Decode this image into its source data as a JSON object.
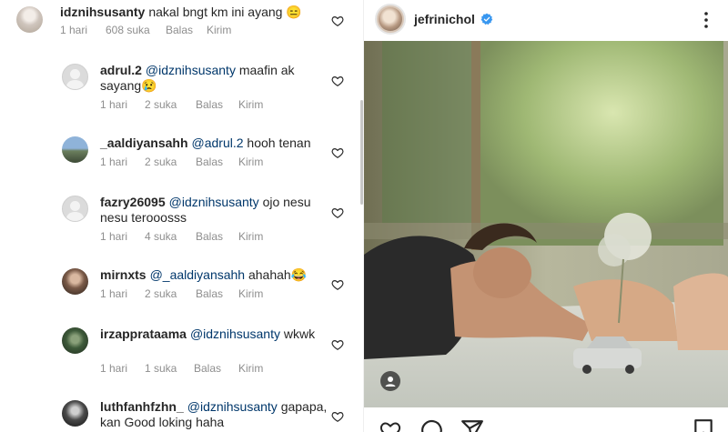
{
  "comments": [
    {
      "username": "idznihsusanty",
      "mention": "",
      "text": "nakal bngt km ini ayang 😑",
      "time": "1 hari",
      "likes": "608 suka",
      "reply": "Balas",
      "send": "Kirim"
    },
    {
      "username": "adrul.2",
      "mention": "@idznihsusanty",
      "text": "maafin ak sayang😢",
      "time": "1 hari",
      "likes": "2 suka",
      "reply": "Balas",
      "send": "Kirim"
    },
    {
      "username": "_aaldiyansahh",
      "mention": "@adrul.2",
      "text": "hooh tenan",
      "time": "1 hari",
      "likes": "2 suka",
      "reply": "Balas",
      "send": "Kirim"
    },
    {
      "username": "fazry26095",
      "mention": "@idznihsusanty",
      "text": "ojo nesu nesu terooosss",
      "time": "1 hari",
      "likes": "4 suka",
      "reply": "Balas",
      "send": "Kirim"
    },
    {
      "username": "mirnxts",
      "mention": "@_aaldiyansahh",
      "text": "ahahah😂",
      "time": "1 hari",
      "likes": "2 suka",
      "reply": "Balas",
      "send": "Kirim"
    },
    {
      "username": "irzapprataama",
      "mention": "@idznihsusanty",
      "text": "wkwk",
      "time": "1 hari",
      "likes": "1 suka",
      "reply": "Balas",
      "send": "Kirim"
    },
    {
      "username": "luthfanhfzhn_",
      "mention": "@idznihsusanty",
      "text": "gapapa, kan Good loking haha",
      "time": "",
      "likes": "",
      "reply": "",
      "send": ""
    }
  ],
  "post": {
    "username": "jefrinichol",
    "verified": true
  },
  "icons": {
    "comment_like": "heart-outline-icon",
    "more": "more-vertical-icon",
    "verified": "verified-badge-icon",
    "tagged": "user-tag-icon",
    "like": "heart-outline-icon",
    "comment": "comment-bubble-icon",
    "share": "send-paper-plane-icon",
    "save": "bookmark-icon"
  },
  "colors": {
    "text": "#262626",
    "secondary": "#8e8e8e",
    "mention": "#00376b",
    "verified": "#3897f0"
  }
}
